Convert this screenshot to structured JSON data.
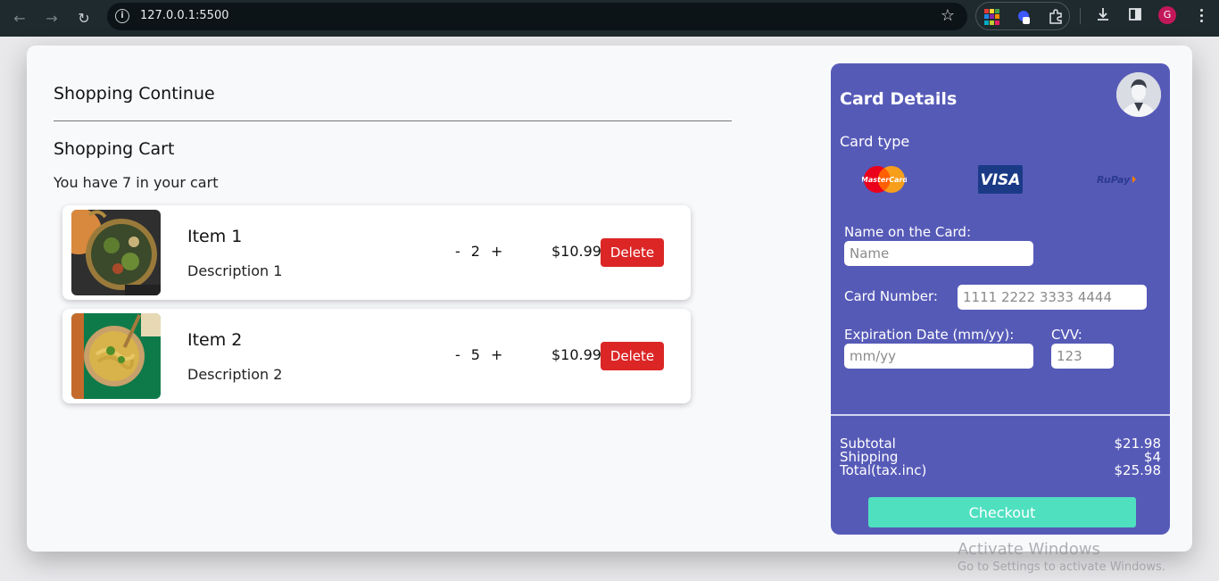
{
  "browser": {
    "url": "127.0.0.1:5500",
    "profile_initial": "G"
  },
  "page": {
    "continue_label": "Shopping Continue",
    "cart_title": "Shopping Cart",
    "cart_count_text": "You have 7 in your cart",
    "items": [
      {
        "name": "Item 1",
        "description": "Description 1",
        "quantity": "2",
        "price": "$10.99",
        "delete_label": "Delete",
        "minus": "-",
        "plus": "+"
      },
      {
        "name": "Item 2",
        "description": "Description 2",
        "quantity": "5",
        "price": "$10.99",
        "delete_label": "Delete",
        "minus": "-",
        "plus": "+"
      }
    ]
  },
  "card": {
    "title": "Card Details",
    "card_type_label": "Card type",
    "logos": {
      "mastercard": "MasterCard",
      "visa": "VISA",
      "rupay": "RuPay"
    },
    "name_label": "Name on the Card:",
    "name_placeholder": "Name",
    "number_label": "Card Number:",
    "number_placeholder": "1111 2222 3333 4444",
    "expiry_label": "Expiration Date (mm/yy):",
    "expiry_placeholder": "mm/yy",
    "cvv_label": "CVV:",
    "cvv_placeholder": "123",
    "subtotal_label": "Subtotal",
    "subtotal_value": "$21.98",
    "shipping_label": "Shipping",
    "shipping_value": "$4",
    "total_label": "Total(tax.inc)",
    "total_value": "$25.98",
    "checkout_label": "Checkout"
  },
  "watermark": {
    "line1": "Activate Windows",
    "line2": "Go to Settings to activate Windows."
  }
}
